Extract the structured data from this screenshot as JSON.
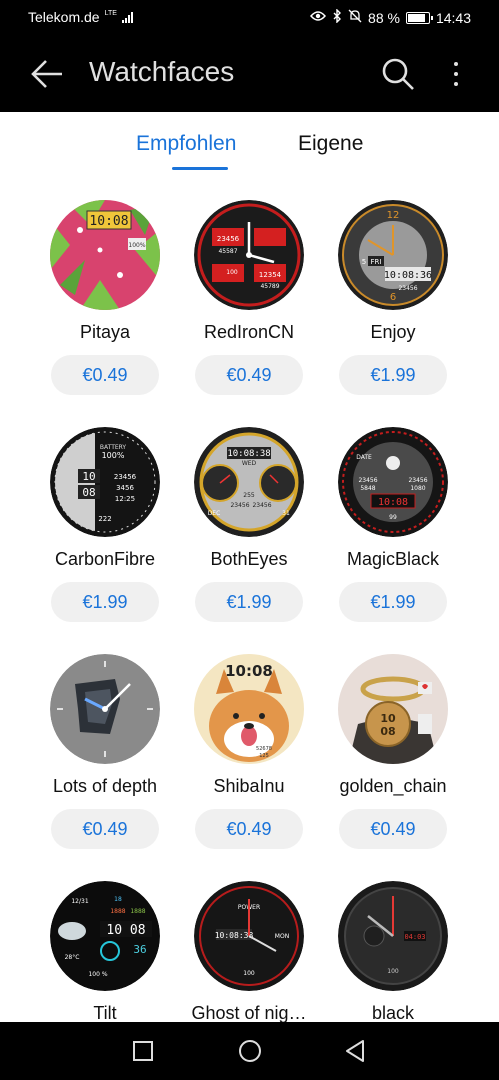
{
  "status": {
    "carrier": "Telekom.de",
    "network": "LTE",
    "battery": "88 %",
    "time": "14:43"
  },
  "appbar": {
    "title": "Watchfaces"
  },
  "tabs": [
    {
      "label": "Empfohlen",
      "active": true
    },
    {
      "label": "Eigene",
      "active": false
    }
  ],
  "accent_color": "#1a73d9",
  "watchfaces": [
    {
      "name": "Pitaya",
      "price": "€0.49",
      "face": {
        "time": "10:08",
        "value": "100%"
      }
    },
    {
      "name": "RedIronCN",
      "price": "€0.49",
      "face": {
        "line1": "23456",
        "line2": "45587",
        "line3": "12354",
        "line4": "45789",
        "value": "100"
      }
    },
    {
      "name": "Enjoy",
      "price": "€1.99",
      "face": {
        "day": "FRI",
        "day_num": "5",
        "time": "10:08:36",
        "steps": "23456",
        "num_top": "12",
        "num_bottom": "6"
      }
    },
    {
      "name": "CarbonFibre",
      "price": "€1.99",
      "face": {
        "label": "BATTERY",
        "value": "100%",
        "hour": "10",
        "minute": "08",
        "steps": "23456",
        "calories": "3456",
        "time": "12:25",
        "num": "222"
      }
    },
    {
      "name": "BothEyes",
      "price": "€1.99",
      "face": {
        "time": "10:08:38",
        "day": "WED",
        "value1": "255",
        "value2": "23456",
        "value3": "23456",
        "month": "DEC",
        "date": "31"
      }
    },
    {
      "name": "MagicBlack",
      "price": "€1.99",
      "face": {
        "label": "DATE",
        "time": "10:08",
        "value1": "23456",
        "value2": "5848",
        "value3": "23456",
        "value4": "1080",
        "value5": "99"
      }
    },
    {
      "name": "Lots of depth",
      "price": "€0.49",
      "face": {}
    },
    {
      "name": "ShibaInu",
      "price": "€0.49",
      "face": {
        "time": "10:08",
        "value1": "52678",
        "value2": "125"
      }
    },
    {
      "name": "golden_chain",
      "price": "€0.49",
      "face": {
        "hour": "10",
        "minute": "08"
      }
    },
    {
      "name": "Tilt",
      "price": "",
      "face": {
        "date": "12/31",
        "value1": "18",
        "value2": "1888",
        "value3": "1888",
        "time": "10 08",
        "value4": "36",
        "temp": "28°C",
        "battery": "100 %"
      }
    },
    {
      "name": "Ghost of nig…",
      "price": "",
      "face": {
        "label": "POWER",
        "time": "10:08:38",
        "day": "MON",
        "value": "100"
      }
    },
    {
      "name": "black",
      "price": "",
      "face": {
        "time": "04:03",
        "value": "100"
      }
    }
  ]
}
